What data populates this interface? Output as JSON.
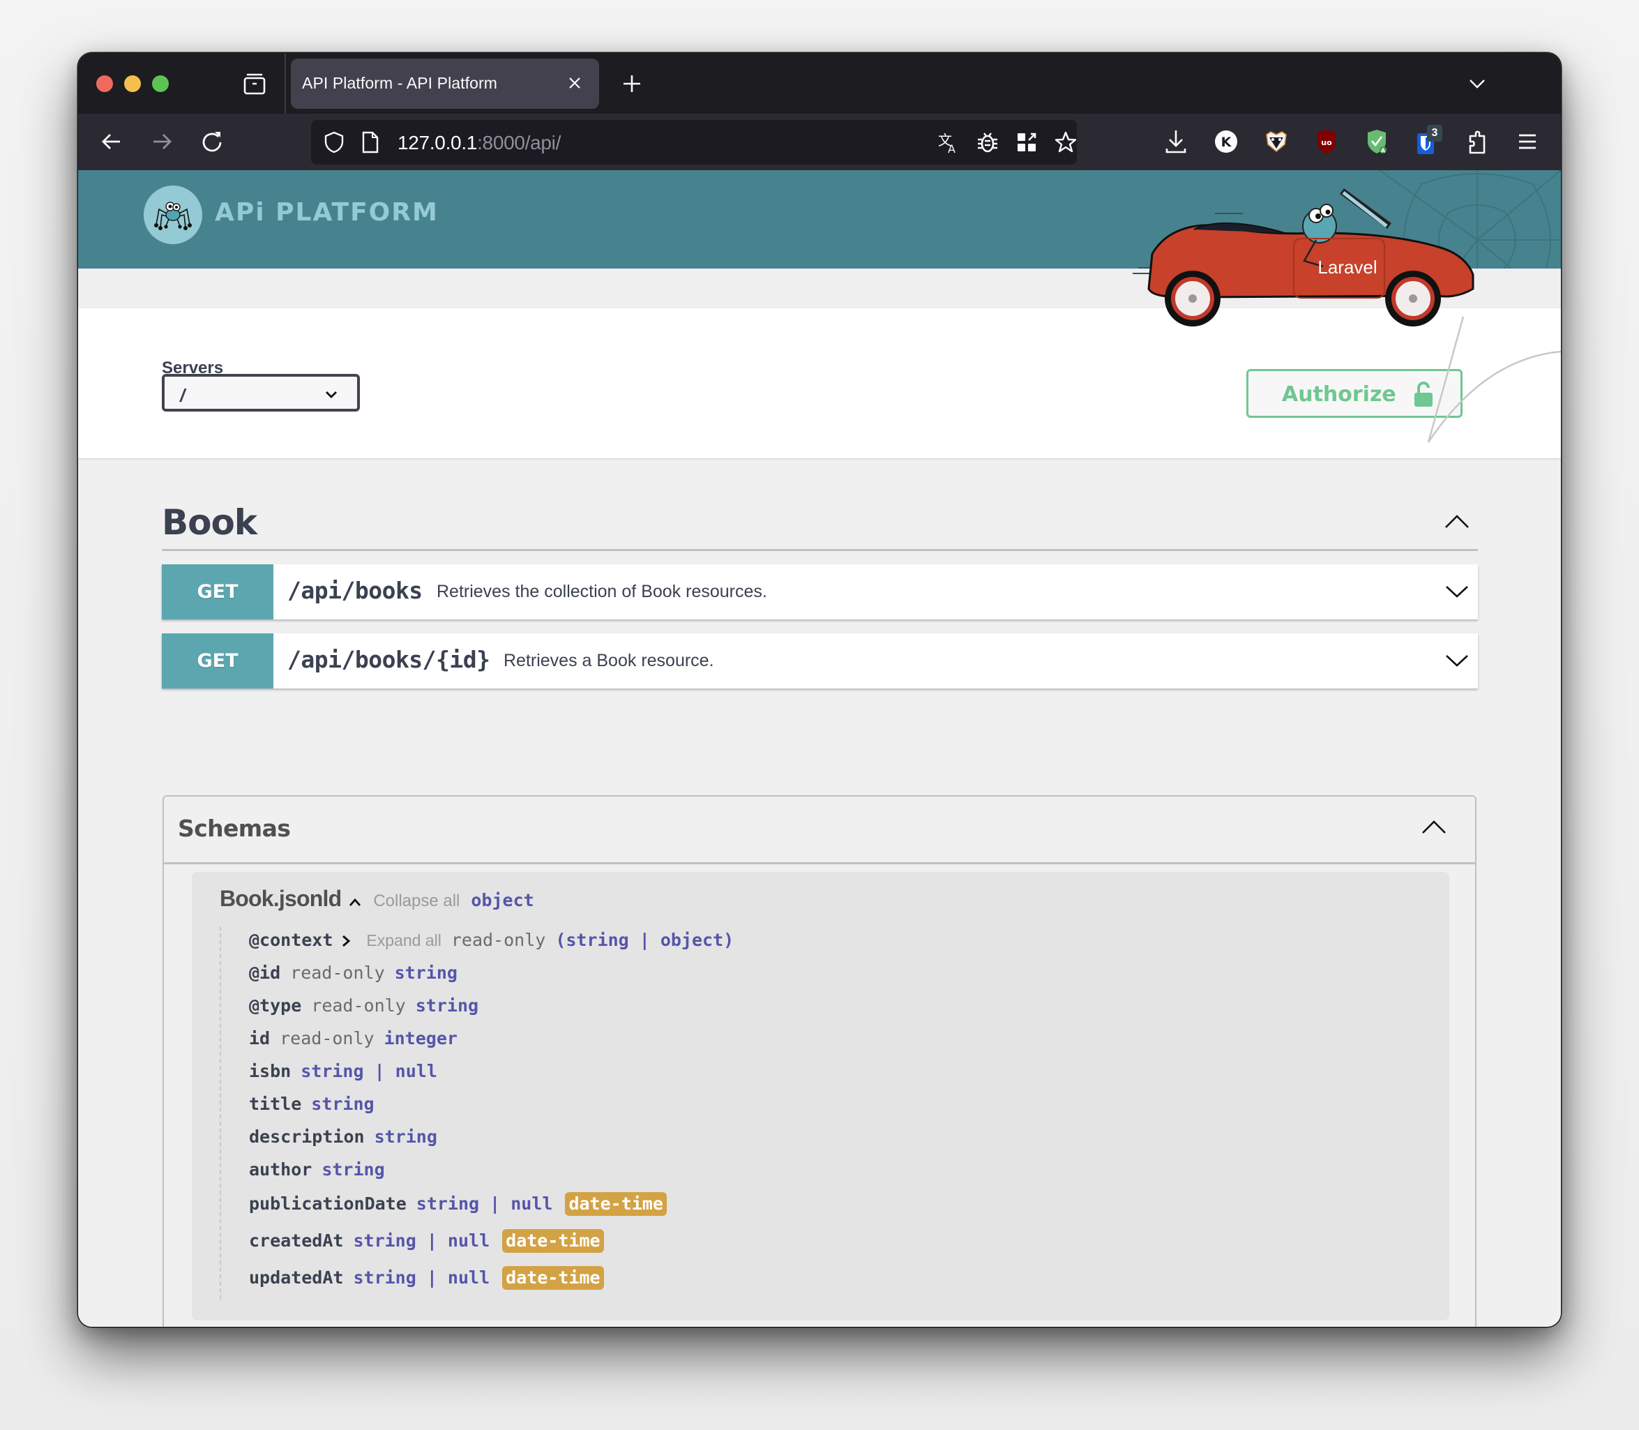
{
  "browser": {
    "tab": {
      "title": "API Platform - API Platform"
    },
    "url": {
      "host": "127.0.0.1",
      "rest": ":8000/api/"
    },
    "extensions_badge": "3",
    "icons": {
      "tabs_view": "tabs-overview-icon",
      "new_tab": "plus-icon",
      "list_tabs": "chevron-down-icon",
      "back": "arrow-left-icon",
      "forward": "arrow-right-icon",
      "reload": "reload-icon",
      "shield": "tracking-protection-shield-icon",
      "page": "page-icon",
      "translate": "translate-icon",
      "bug": "bug-icon",
      "qr": "qr-code-icon",
      "star": "bookmark-star-icon",
      "download": "download-icon",
      "k_ext": "k-extension-icon",
      "badger": "privacy-badger-icon",
      "ublock": "ublock-origin-icon",
      "adguard": "adguard-icon",
      "bitwarden": "bitwarden-icon",
      "extensions": "puzzle-extensions-icon",
      "menu": "hamburger-menu-icon"
    }
  },
  "header": {
    "logo_text": "APi PLATFORM",
    "car_label": "Laravel"
  },
  "servers": {
    "label": "Servers",
    "selected": "/"
  },
  "authorize": {
    "label": "Authorize"
  },
  "tag": {
    "name": "Book",
    "operations": [
      {
        "method": "GET",
        "path": "/api/books",
        "summary": "Retrieves the collection of Book resources."
      },
      {
        "method": "GET",
        "path": "/api/books/{id}",
        "summary": "Retrieves a Book resource."
      }
    ]
  },
  "schemas": {
    "title": "Schemas",
    "model": {
      "name": "Book.jsonld",
      "collapse_label": "Collapse all",
      "type": "object",
      "properties": [
        {
          "name": "@context",
          "expand": "Expand all",
          "readonly": "read-only",
          "type": "(string | object)",
          "format": ""
        },
        {
          "name": "@id",
          "readonly": "read-only",
          "type": "string",
          "format": ""
        },
        {
          "name": "@type",
          "readonly": "read-only",
          "type": "string",
          "format": ""
        },
        {
          "name": "id",
          "readonly": "read-only",
          "type": "integer",
          "format": ""
        },
        {
          "name": "isbn",
          "readonly": "",
          "type": "string | null",
          "format": ""
        },
        {
          "name": "title",
          "readonly": "",
          "type": "string",
          "format": ""
        },
        {
          "name": "description",
          "readonly": "",
          "type": "string",
          "format": ""
        },
        {
          "name": "author",
          "readonly": "",
          "type": "string",
          "format": ""
        },
        {
          "name": "publicationDate",
          "readonly": "",
          "type": "string | null",
          "format": "date-time"
        },
        {
          "name": "createdAt",
          "readonly": "",
          "type": "string | null",
          "format": "date-time"
        },
        {
          "name": "updatedAt",
          "readonly": "",
          "type": "string | null",
          "format": "date-time"
        }
      ]
    }
  },
  "colors": {
    "header_bg": "#47838e",
    "get_method": "#5ca6b0",
    "authorize": "#6fc791",
    "type": "#5555aa",
    "format_badge": "#d3a244"
  }
}
